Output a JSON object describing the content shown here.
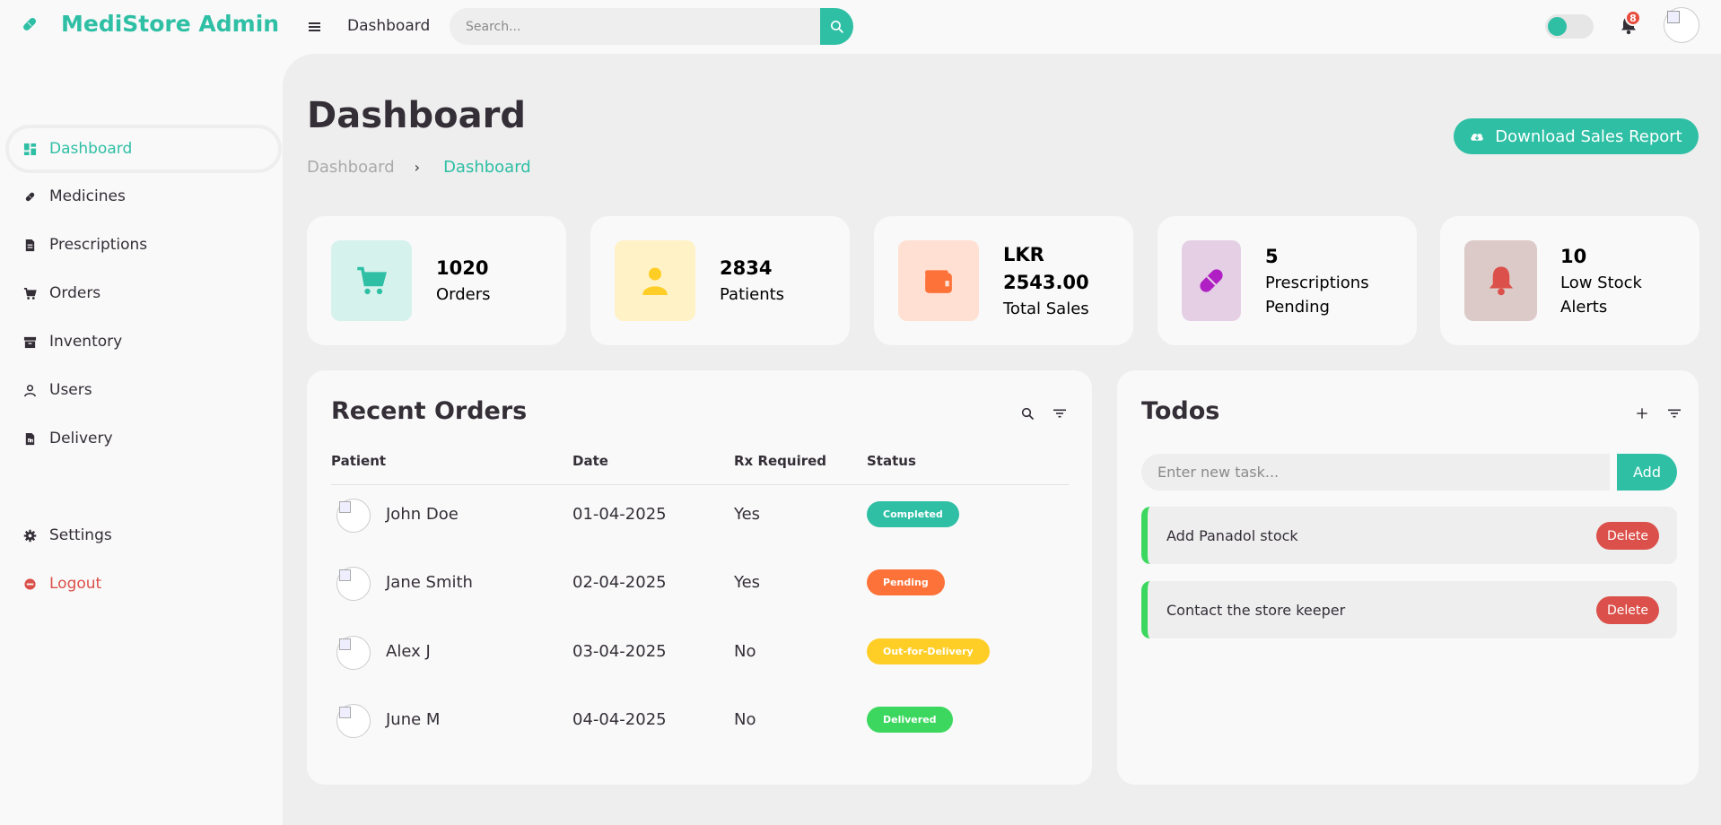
{
  "app": {
    "brand": "MediStore Admin",
    "top_title": "Dashboard"
  },
  "search": {
    "placeholder": "Search..."
  },
  "notifications": {
    "count": "8"
  },
  "sidebar": {
    "items": [
      {
        "label": "Dashboard",
        "icon": "dashboard-icon"
      },
      {
        "label": "Medicines",
        "icon": "pill-icon"
      },
      {
        "label": "Prescriptions",
        "icon": "document-icon"
      },
      {
        "label": "Orders",
        "icon": "cart-icon"
      },
      {
        "label": "Inventory",
        "icon": "archive-icon"
      },
      {
        "label": "Users",
        "icon": "user-icon"
      },
      {
        "label": "Delivery",
        "icon": "file-icon"
      }
    ],
    "settings": "Settings",
    "logout": "Logout"
  },
  "page": {
    "title": "Dashboard",
    "breadcrumb_home": "Dashboard",
    "breadcrumb_sep": "›",
    "breadcrumb_current": "Dashboard",
    "download_label": "Download Sales Report"
  },
  "stats": [
    {
      "value": "1020",
      "label": "Orders",
      "icon": "cart-icon",
      "color": "#2ebfa5",
      "bg": "#d6f2ed"
    },
    {
      "value": "2834",
      "label": "Patients",
      "icon": "user-icon",
      "color": "#ffce26",
      "bg": "#fff2c6"
    },
    {
      "value": "LKR 2543.00",
      "label": "Total Sales",
      "icon": "wallet-icon",
      "color": "#fd7238",
      "bg": "#ffe0d3"
    },
    {
      "value": "5",
      "label": "Prescriptions Pending",
      "icon": "pill-icon",
      "color": "#b01fc4",
      "bg": "#e5cfe4"
    },
    {
      "value": "10",
      "label": "Low Stock Alerts",
      "icon": "bell-icon",
      "color": "#db504a",
      "bg": "#dccac8"
    }
  ],
  "recent_orders": {
    "title": "Recent Orders",
    "columns": [
      "Patient",
      "Date",
      "Rx Required",
      "Status"
    ],
    "rows": [
      {
        "patient": "John Doe",
        "date": "01-04-2025",
        "rx": "Yes",
        "status": "Completed",
        "status_color": "#2ebfa5"
      },
      {
        "patient": "Jane Smith",
        "date": "02-04-2025",
        "rx": "Yes",
        "status": "Pending",
        "status_color": "#fd7238"
      },
      {
        "patient": "Alex J",
        "date": "03-04-2025",
        "rx": "No",
        "status": "Out-for-Delivery",
        "status_color": "#ffce26"
      },
      {
        "patient": "June M",
        "date": "04-04-2025",
        "rx": "No",
        "status": "Delivered",
        "status_color": "#3cd75f"
      }
    ]
  },
  "todos": {
    "title": "Todos",
    "input_placeholder": "Enter new task...",
    "add_label": "Add",
    "items": [
      {
        "text": "Add Panadol stock",
        "delete_label": "Delete"
      },
      {
        "text": "Contact the store keeper",
        "delete_label": "Delete"
      }
    ]
  },
  "colors": {
    "accent": "#2ebfa5",
    "danger": "#db504a",
    "dark": "#342e37"
  }
}
